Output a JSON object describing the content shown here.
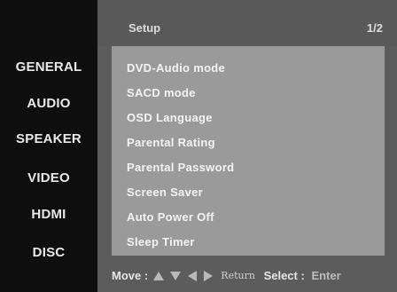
{
  "sidebar": {
    "items": [
      "GENERAL",
      "AUDIO",
      "SPEAKER",
      "VIDEO",
      "HDMI",
      "DISC"
    ]
  },
  "header": {
    "title": "Setup",
    "page": "1/2"
  },
  "menu": {
    "items": [
      "DVD-Audio mode",
      "SACD mode",
      "OSD Language",
      "Parental Rating",
      "Parental Password",
      "Screen Saver",
      "Auto Power Off",
      "Sleep Timer"
    ]
  },
  "footer": {
    "move_label": "Move :",
    "return_label": "Return",
    "select_label": "Select :",
    "enter_label": "Enter",
    "icons": [
      "up-arrow-icon",
      "down-arrow-icon",
      "left-arrow-icon",
      "right-arrow-icon"
    ]
  },
  "colors": {
    "panel": "#9a9a9a",
    "frame": "#5c5c5c",
    "sidebar": "#0e0e0e",
    "text": "#f4f4f4"
  }
}
